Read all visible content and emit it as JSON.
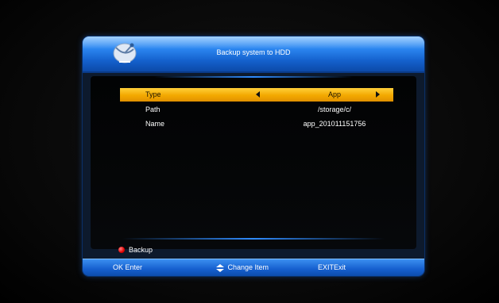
{
  "dialog": {
    "title": "Backup system to HDD",
    "logo_icon": "satellite-dish-icon"
  },
  "rows": [
    {
      "label": "Type",
      "value": "App",
      "selected": true
    },
    {
      "label": "Path",
      "value": "/storage/c/",
      "selected": false
    },
    {
      "label": "Name",
      "value": "app_201011151756",
      "selected": false
    }
  ],
  "actions": {
    "backup_label": "Backup",
    "backup_color": "#e00000"
  },
  "footer": {
    "ok_key": "OK",
    "ok_label": "Enter",
    "change_label": "Change Item",
    "exit_key": "EXIT",
    "exit_label": "Exit"
  },
  "colors": {
    "accent_blue": "#1460cc",
    "highlight": "#f3a900"
  }
}
